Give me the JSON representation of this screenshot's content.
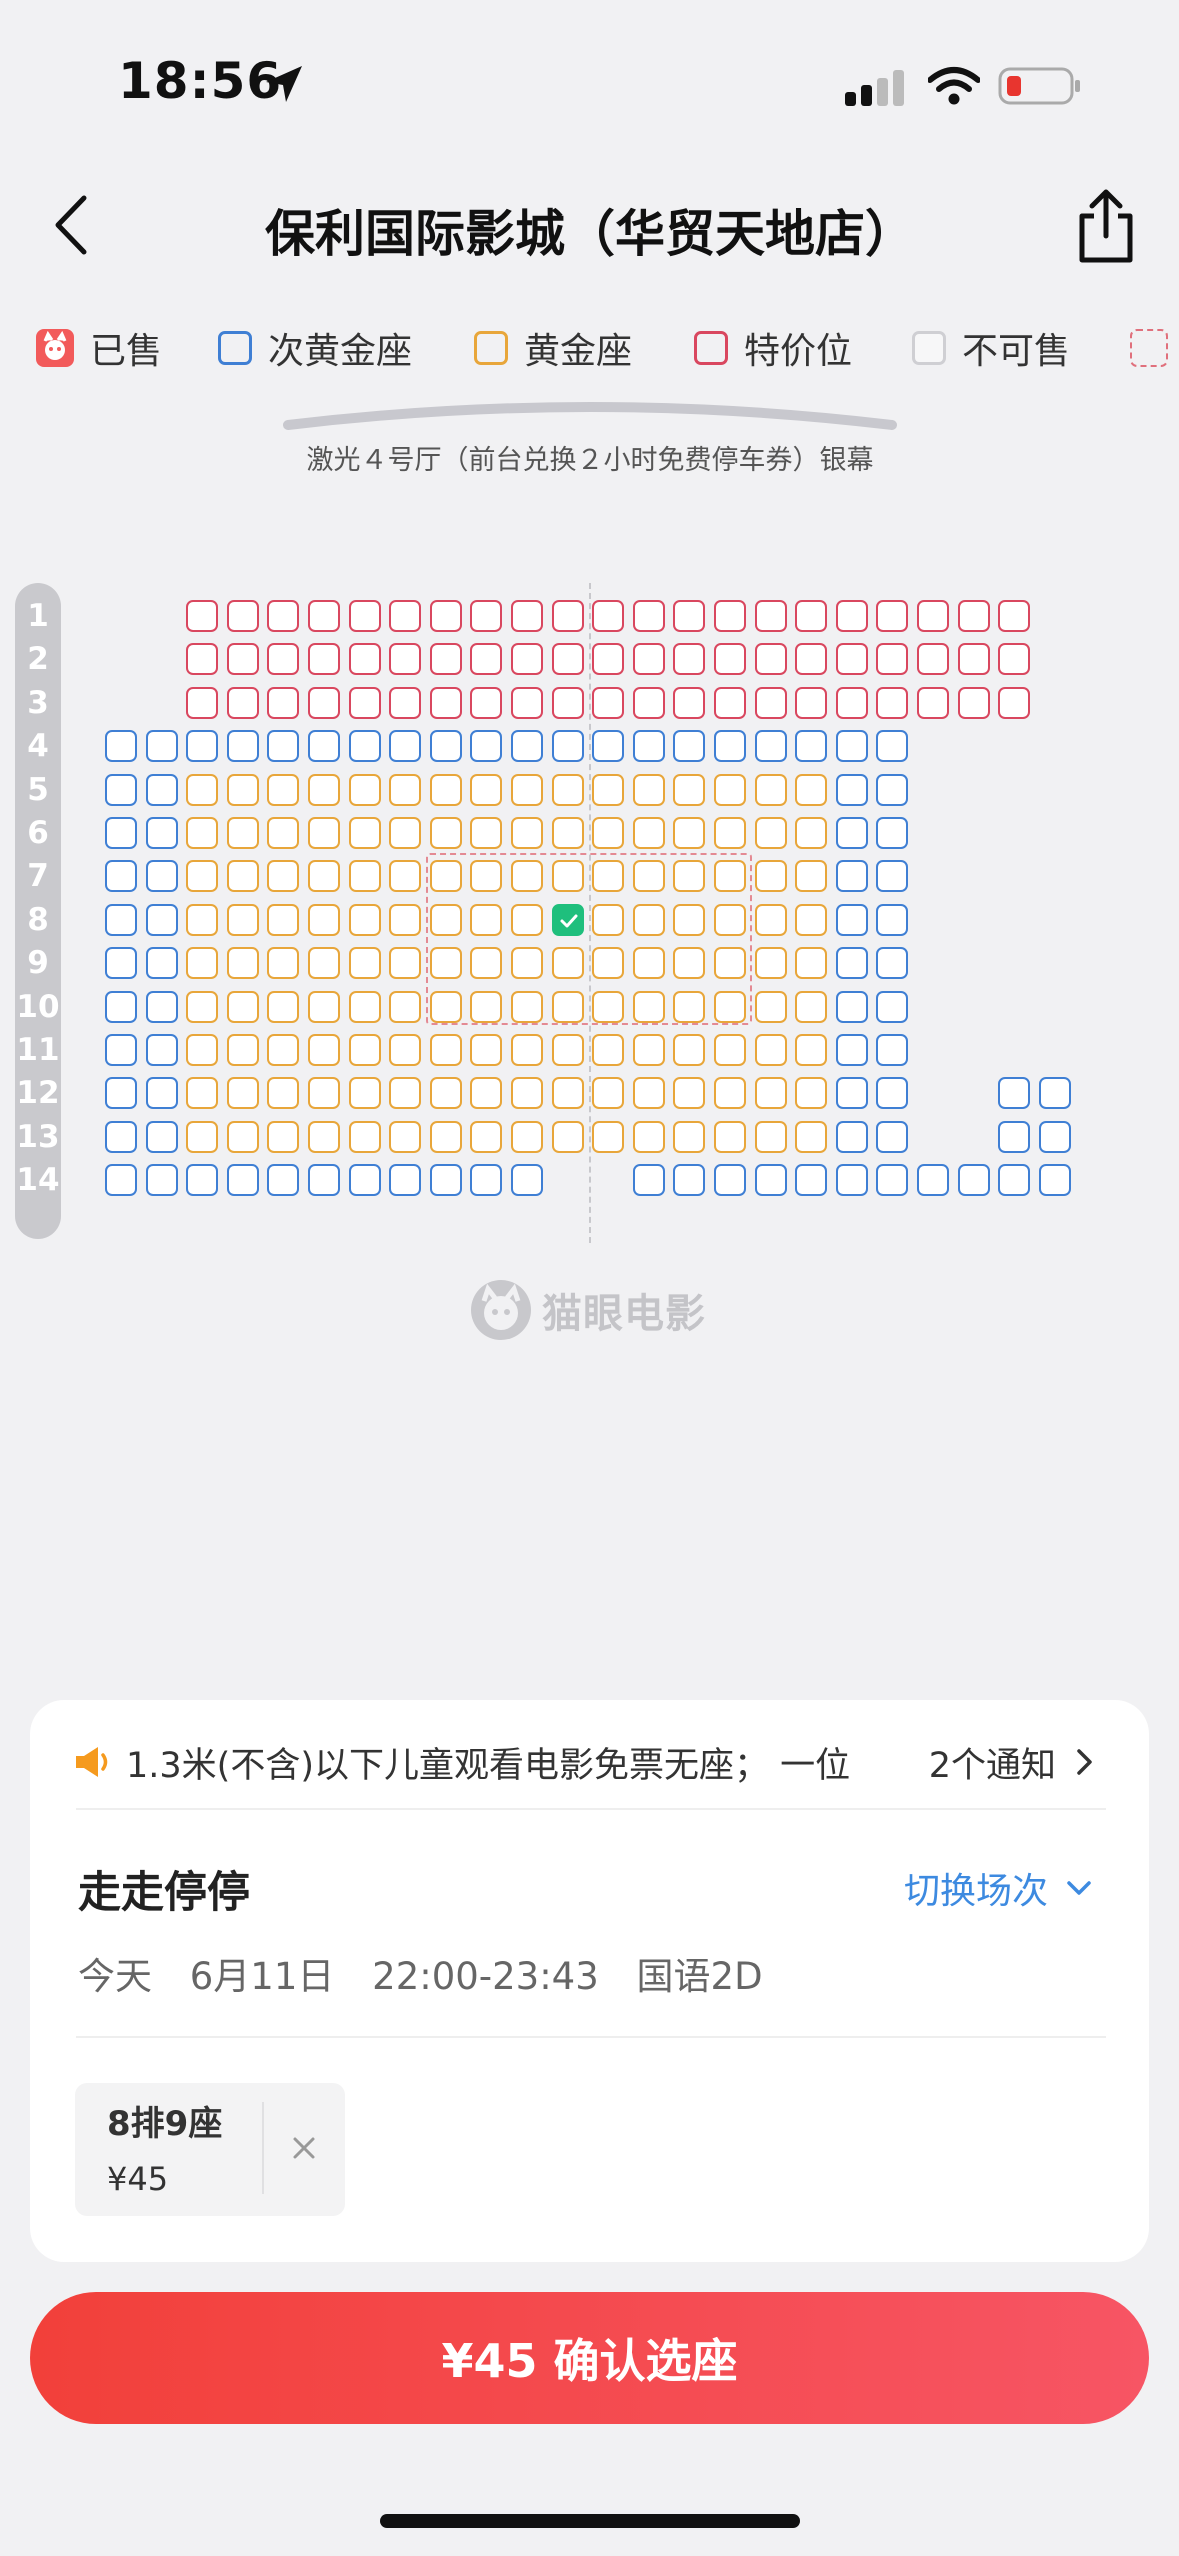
{
  "status_bar": {
    "time": "18:56"
  },
  "nav": {
    "title": "保利国际影城（华贸天地店）"
  },
  "legend": [
    {
      "label": "已售",
      "kind": "sold",
      "color": "#f25a5a"
    },
    {
      "label": "次黄金座",
      "kind": "outline",
      "color": "#3f7fd4"
    },
    {
      "label": "黄金座",
      "kind": "outline",
      "color": "#e8a63a"
    },
    {
      "label": "特价位",
      "kind": "outline",
      "color": "#d9475f"
    },
    {
      "label": "不可售",
      "kind": "outline",
      "color": "#cfcfd3"
    },
    {
      "label": "",
      "kind": "dashed",
      "color": "#e0707c"
    }
  ],
  "screen": {
    "label": "激光４号厅（前台兑换２小时免费停车券）银幕"
  },
  "seat_map": {
    "rows": [
      "1",
      "2",
      "3",
      "4",
      "5",
      "6",
      "7",
      "8",
      "9",
      "10",
      "11",
      "12",
      "13",
      "14"
    ],
    "selected": {
      "row": "8",
      "seat": "9"
    },
    "watermark": "猫眼电影"
  },
  "panel": {
    "notice": "1.3米(不含)以下儿童观看电影免票无座；  一位",
    "notice_link": "2个通知",
    "movie_title": "走走停停",
    "switch_label": "切换场次",
    "showtime": {
      "day": "今天",
      "date": "6月11日",
      "time": "22:00-23:43",
      "format": "国语2D"
    },
    "chosen_seat": {
      "label": "8排9座",
      "price": "¥45"
    }
  },
  "confirm_button": "¥45 确认选座",
  "colors": {
    "accent": "#f2403a",
    "link": "#3d8ae0",
    "selected_seat": "#1fbf7d"
  }
}
